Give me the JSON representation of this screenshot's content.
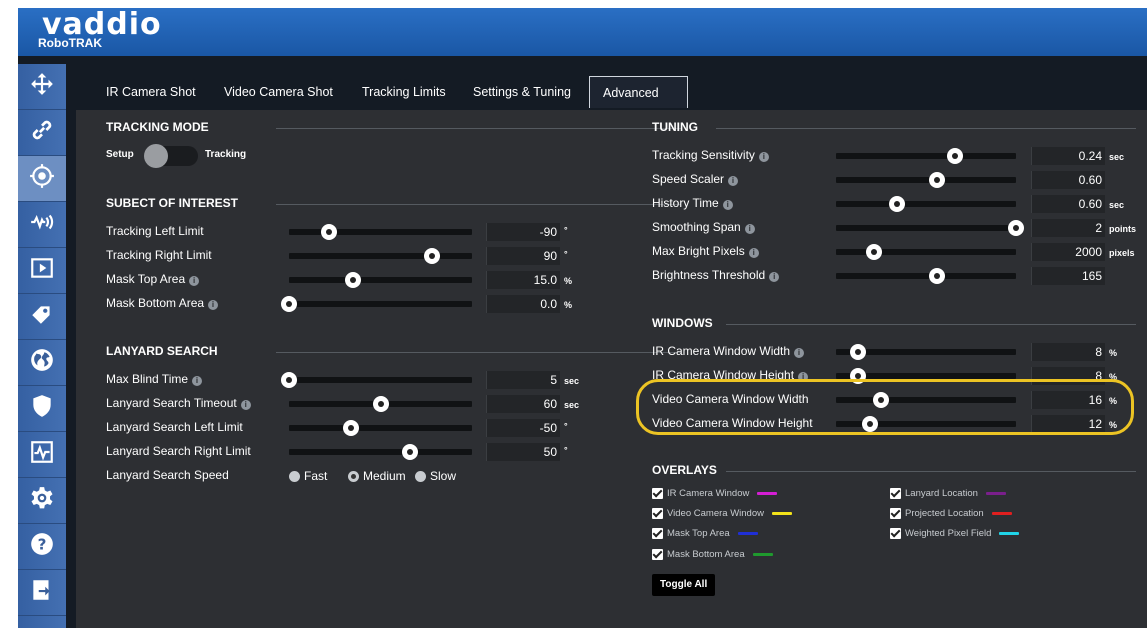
{
  "app": {
    "brand": "vaddio",
    "product": "RoboTRAK"
  },
  "sidebar": {
    "items": [
      {
        "icon": "move-arrows-icon"
      },
      {
        "icon": "link-icon"
      },
      {
        "icon": "target-icon",
        "active": true
      },
      {
        "icon": "audio-icon"
      },
      {
        "icon": "play-icon"
      },
      {
        "icon": "tag-icon"
      },
      {
        "icon": "globe-icon"
      },
      {
        "icon": "shield-icon"
      },
      {
        "icon": "pulse-icon"
      },
      {
        "icon": "gear-icon"
      },
      {
        "icon": "help-icon"
      },
      {
        "icon": "export-icon"
      }
    ]
  },
  "tabs": [
    {
      "label": "IR Camera Shot"
    },
    {
      "label": "Video Camera Shot"
    },
    {
      "label": "Tracking Limits"
    },
    {
      "label": "Settings & Tuning"
    },
    {
      "label": "Advanced",
      "active": true
    }
  ],
  "tracking_mode": {
    "title": "TRACKING MODE",
    "left_label": "Setup",
    "right_label": "Tracking"
  },
  "subject": {
    "title": "SUBECT OF INTEREST",
    "rows": [
      {
        "label": "Tracking Left Limit",
        "info": false,
        "value": "-90",
        "unit": "°",
        "level": 0.22
      },
      {
        "label": "Tracking Right Limit",
        "info": false,
        "value": "90",
        "unit": "°",
        "level": 0.78
      },
      {
        "label": "Mask Top Area",
        "info": true,
        "value": "15.0",
        "unit": "%",
        "level": 0.35
      },
      {
        "label": "Mask Bottom Area",
        "info": true,
        "value": "0.0",
        "unit": "%",
        "level": 0.0
      }
    ]
  },
  "lanyard": {
    "title": "LANYARD SEARCH",
    "rows": [
      {
        "label": "Max Blind Time",
        "info": true,
        "value": "5",
        "unit": "sec",
        "level": 0.0
      },
      {
        "label": "Lanyard Search Timeout",
        "info": true,
        "value": "60",
        "unit": "sec",
        "level": 0.5
      },
      {
        "label": "Lanyard Search Left Limit",
        "info": false,
        "value": "-50",
        "unit": "°",
        "level": 0.34
      },
      {
        "label": "Lanyard Search Right Limit",
        "info": false,
        "value": "50",
        "unit": "°",
        "level": 0.66
      }
    ],
    "speed_label": "Lanyard Search Speed",
    "speed_options": [
      {
        "label": "Fast",
        "selected": false
      },
      {
        "label": "Medium",
        "selected": true
      },
      {
        "label": "Slow",
        "selected": false
      }
    ]
  },
  "tuning": {
    "title": "TUNING",
    "rows": [
      {
        "label": "Tracking Sensitivity",
        "value": "0.24",
        "unit": "sec",
        "level": 0.66
      },
      {
        "label": "Speed Scaler",
        "value": "0.60",
        "unit": "",
        "level": 0.56
      },
      {
        "label": "History Time",
        "value": "0.60",
        "unit": "sec",
        "level": 0.34
      },
      {
        "label": "Smoothing Span",
        "value": "2",
        "unit": "points",
        "level": 1.0
      },
      {
        "label": "Max Bright Pixels",
        "value": "2000",
        "unit": "pixels",
        "level": 0.21
      },
      {
        "label": "Brightness Threshold",
        "value": "165",
        "unit": "",
        "level": 0.56
      }
    ]
  },
  "windows": {
    "title": "WINDOWS",
    "rows": [
      {
        "label": "IR Camera Window Width",
        "info": true,
        "value": "8",
        "unit": "%",
        "level": 0.12
      },
      {
        "label": "IR Camera Window Height",
        "info": true,
        "value": "8",
        "unit": "%",
        "level": 0.12
      },
      {
        "label": "Video Camera Window Width",
        "info": false,
        "value": "16",
        "unit": "%",
        "level": 0.25
      },
      {
        "label": "Video Camera Window Height",
        "info": false,
        "value": "12",
        "unit": "%",
        "level": 0.19
      }
    ]
  },
  "overlays": {
    "title": "OVERLAYS",
    "items": [
      {
        "label": "IR Camera Window",
        "color": "#d41ed4"
      },
      {
        "label": "Video Camera Window",
        "color": "#f2e21a"
      },
      {
        "label": "Mask Top Area",
        "color": "#1f2fd6"
      },
      {
        "label": "Mask Bottom Area",
        "color": "#1f9a2e"
      },
      {
        "label": "Lanyard Location",
        "color": "#7a1f8c"
      },
      {
        "label": "Projected Location",
        "color": "#e01f1f"
      },
      {
        "label": "Weighted Pixel Field",
        "color": "#20d4e8"
      }
    ],
    "toggle_all_label": "Toggle All"
  },
  "colors": {
    "highlight": "#ecc424",
    "banner": "#1d5fb2",
    "sidebar": "#3a5f9a"
  }
}
